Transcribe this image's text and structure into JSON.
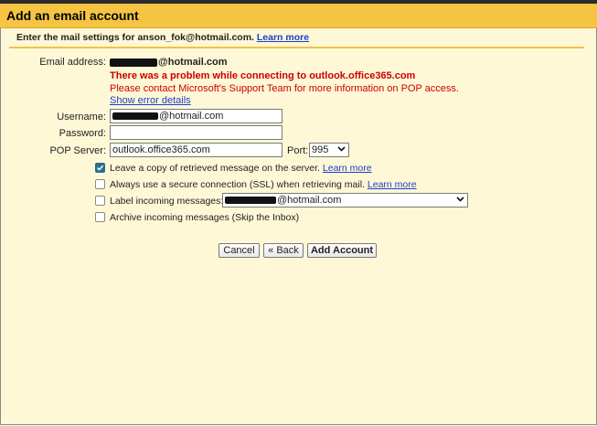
{
  "dialog": {
    "title": "Add an email account",
    "intro_text": "Enter the mail settings for anson_fok@hotmail.com.",
    "intro_link": "Learn more"
  },
  "form": {
    "email_label": "Email address:",
    "email_value": "@hotmail.com",
    "error_title": "There was a problem while connecting to outlook.office365.com",
    "error_detail": "Please contact Microsoft's Support Team for more information on POP access.",
    "error_link": "Show error details",
    "username_label": "Username:",
    "username_value": "@hotmail.com",
    "password_label": "Password:",
    "password_value": "",
    "pop_label": "POP Server:",
    "pop_value": "outlook.office365.com",
    "port_label": "Port:",
    "port_value": "995"
  },
  "options": {
    "leave_copy": {
      "label": "Leave a copy of retrieved message on the server.",
      "link": "Learn more",
      "checked": true
    },
    "ssl": {
      "label": "Always use a secure connection (SSL) when retrieving mail.",
      "link": "Learn more",
      "checked": false
    },
    "label_incoming": {
      "label": "Label incoming messages:",
      "select_value": "@hotmail.com",
      "checked": false
    },
    "archive": {
      "label": "Archive incoming messages (Skip the Inbox)",
      "checked": false
    }
  },
  "buttons": {
    "cancel": "Cancel",
    "back": "« Back",
    "add": "Add Account"
  },
  "colors": {
    "title_bar": "#f6c443",
    "background": "#fff8d6",
    "error": "#cc0000",
    "link": "#1a3fd0",
    "checked": "#2a6f8e"
  }
}
